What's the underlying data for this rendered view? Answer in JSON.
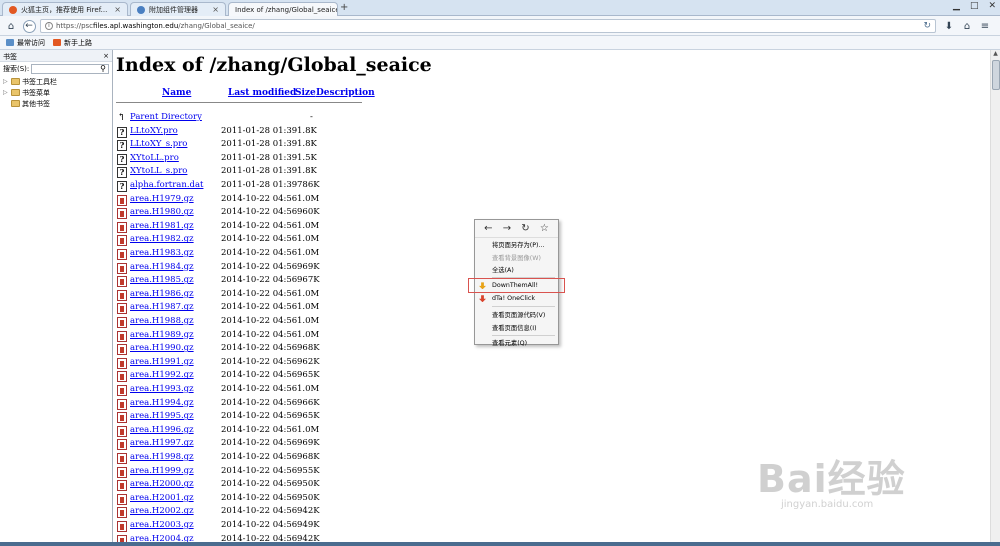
{
  "window": {
    "tabs": [
      {
        "label": "火狐主页，推荐使用 Firef...",
        "color": "#e25822"
      },
      {
        "label": "附加组件管理器",
        "color": "#4a7fc1"
      },
      {
        "label": "Index of /zhang/Global_seaice",
        "color": "#f6f8fb"
      }
    ],
    "new_tab": "+",
    "controls": {
      "minimize": "▁",
      "maximize": "□",
      "close": "✕"
    }
  },
  "navbar": {
    "url_prefix": "https://psc",
    "url_host": "files.apl.washington.edu",
    "url_path": "/zhang/Global_seaice/"
  },
  "bookmarks_toolbar": [
    {
      "label": "最常访问"
    },
    {
      "label": "新手上路"
    }
  ],
  "sidebar": {
    "title": "书签",
    "close": "×",
    "search_label": "搜索(S):",
    "tree": [
      {
        "label": "书签工具栏",
        "expandable": true
      },
      {
        "label": "书签菜单",
        "expandable": true
      },
      {
        "label": "其他书签",
        "expandable": false
      }
    ]
  },
  "listing": {
    "title": "Index of /zhang/Global_seaice",
    "columns": {
      "name": "Name",
      "modified": "Last modified",
      "size": "Size",
      "description": "Description"
    },
    "parent": {
      "name": "Parent Directory",
      "size": "-"
    },
    "files": [
      {
        "name": "LLtoXY.pro",
        "modified": "2011-01-28 01:39",
        "size": "1.8K",
        "type": "text"
      },
      {
        "name": "LLtoXY_s.pro",
        "modified": "2011-01-28 01:39",
        "size": "1.8K",
        "type": "text"
      },
      {
        "name": "XYtoLL.pro",
        "modified": "2011-01-28 01:39",
        "size": "1.5K",
        "type": "text"
      },
      {
        "name": "XYtoLL_s.pro",
        "modified": "2011-01-28 01:39",
        "size": "1.8K",
        "type": "text"
      },
      {
        "name": "alpha.fortran.dat",
        "modified": "2011-01-28 01:39",
        "size": "786K",
        "type": "text"
      },
      {
        "name": "area.H1979.gz",
        "modified": "2014-10-22 04:56",
        "size": "1.0M",
        "type": "gz"
      },
      {
        "name": "area.H1980.gz",
        "modified": "2014-10-22 04:56",
        "size": "960K",
        "type": "gz"
      },
      {
        "name": "area.H1981.gz",
        "modified": "2014-10-22 04:56",
        "size": "1.0M",
        "type": "gz"
      },
      {
        "name": "area.H1982.gz",
        "modified": "2014-10-22 04:56",
        "size": "1.0M",
        "type": "gz"
      },
      {
        "name": "area.H1983.gz",
        "modified": "2014-10-22 04:56",
        "size": "1.0M",
        "type": "gz"
      },
      {
        "name": "area.H1984.gz",
        "modified": "2014-10-22 04:56",
        "size": "969K",
        "type": "gz"
      },
      {
        "name": "area.H1985.gz",
        "modified": "2014-10-22 04:56",
        "size": "967K",
        "type": "gz"
      },
      {
        "name": "area.H1986.gz",
        "modified": "2014-10-22 04:56",
        "size": "1.0M",
        "type": "gz"
      },
      {
        "name": "area.H1987.gz",
        "modified": "2014-10-22 04:56",
        "size": "1.0M",
        "type": "gz"
      },
      {
        "name": "area.H1988.gz",
        "modified": "2014-10-22 04:56",
        "size": "1.0M",
        "type": "gz"
      },
      {
        "name": "area.H1989.gz",
        "modified": "2014-10-22 04:56",
        "size": "1.0M",
        "type": "gz"
      },
      {
        "name": "area.H1990.gz",
        "modified": "2014-10-22 04:56",
        "size": "968K",
        "type": "gz"
      },
      {
        "name": "area.H1991.gz",
        "modified": "2014-10-22 04:56",
        "size": "962K",
        "type": "gz"
      },
      {
        "name": "area.H1992.gz",
        "modified": "2014-10-22 04:56",
        "size": "965K",
        "type": "gz"
      },
      {
        "name": "area.H1993.gz",
        "modified": "2014-10-22 04:56",
        "size": "1.0M",
        "type": "gz"
      },
      {
        "name": "area.H1994.gz",
        "modified": "2014-10-22 04:56",
        "size": "966K",
        "type": "gz"
      },
      {
        "name": "area.H1995.gz",
        "modified": "2014-10-22 04:56",
        "size": "965K",
        "type": "gz"
      },
      {
        "name": "area.H1996.gz",
        "modified": "2014-10-22 04:56",
        "size": "1.0M",
        "type": "gz"
      },
      {
        "name": "area.H1997.gz",
        "modified": "2014-10-22 04:56",
        "size": "969K",
        "type": "gz"
      },
      {
        "name": "area.H1998.gz",
        "modified": "2014-10-22 04:56",
        "size": "968K",
        "type": "gz"
      },
      {
        "name": "area.H1999.gz",
        "modified": "2014-10-22 04:56",
        "size": "955K",
        "type": "gz"
      },
      {
        "name": "area.H2000.gz",
        "modified": "2014-10-22 04:56",
        "size": "950K",
        "type": "gz"
      },
      {
        "name": "area.H2001.gz",
        "modified": "2014-10-22 04:56",
        "size": "950K",
        "type": "gz"
      },
      {
        "name": "area.H2002.gz",
        "modified": "2014-10-22 04:56",
        "size": "942K",
        "type": "gz"
      },
      {
        "name": "area.H2003.gz",
        "modified": "2014-10-22 04:56",
        "size": "949K",
        "type": "gz"
      },
      {
        "name": "area.H2004.gz",
        "modified": "2014-10-22 04:56",
        "size": "942K",
        "type": "gz"
      }
    ]
  },
  "context_menu": {
    "nav": {
      "back": "←",
      "forward": "→",
      "reload": "↻",
      "bookmark": "☆"
    },
    "items": [
      {
        "label": "将页面另存为(P)...",
        "disabled": false
      },
      {
        "label": "查看背景图像(W)",
        "disabled": true
      },
      {
        "label": "全选(A)",
        "disabled": false
      },
      {
        "label": "DownThemAll!",
        "disabled": false
      },
      {
        "label": "dTa! OneClick",
        "disabled": false
      },
      {
        "label": "查看页面源代码(V)",
        "disabled": false
      },
      {
        "label": "查看页面信息(I)",
        "disabled": false
      },
      {
        "label": "查看元素(Q)",
        "disabled": false
      }
    ],
    "highlighted_item": "DownThemAll!",
    "highlight_color": "#d9534f"
  },
  "watermark": {
    "main": "Bai经验",
    "sub": "jingyan.baidu.com"
  }
}
